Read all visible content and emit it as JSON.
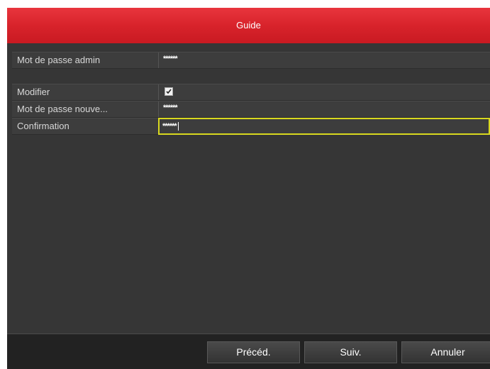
{
  "dialog": {
    "title": "Guide"
  },
  "form": {
    "rows": [
      {
        "label": "Mot de passe admin",
        "value": "******"
      },
      {
        "label": "Modifier",
        "checked": true
      },
      {
        "label": "Mot de passe nouve...",
        "value": "******"
      },
      {
        "label": "Confirmation",
        "value": "******"
      }
    ]
  },
  "footer": {
    "prev_label": "Précéd.",
    "next_label": "Suiv.",
    "cancel_label": "Annuler"
  },
  "colors": {
    "title_bar": "#d8232b",
    "focus_border": "#d8d81f",
    "panel_background": "#363636"
  }
}
